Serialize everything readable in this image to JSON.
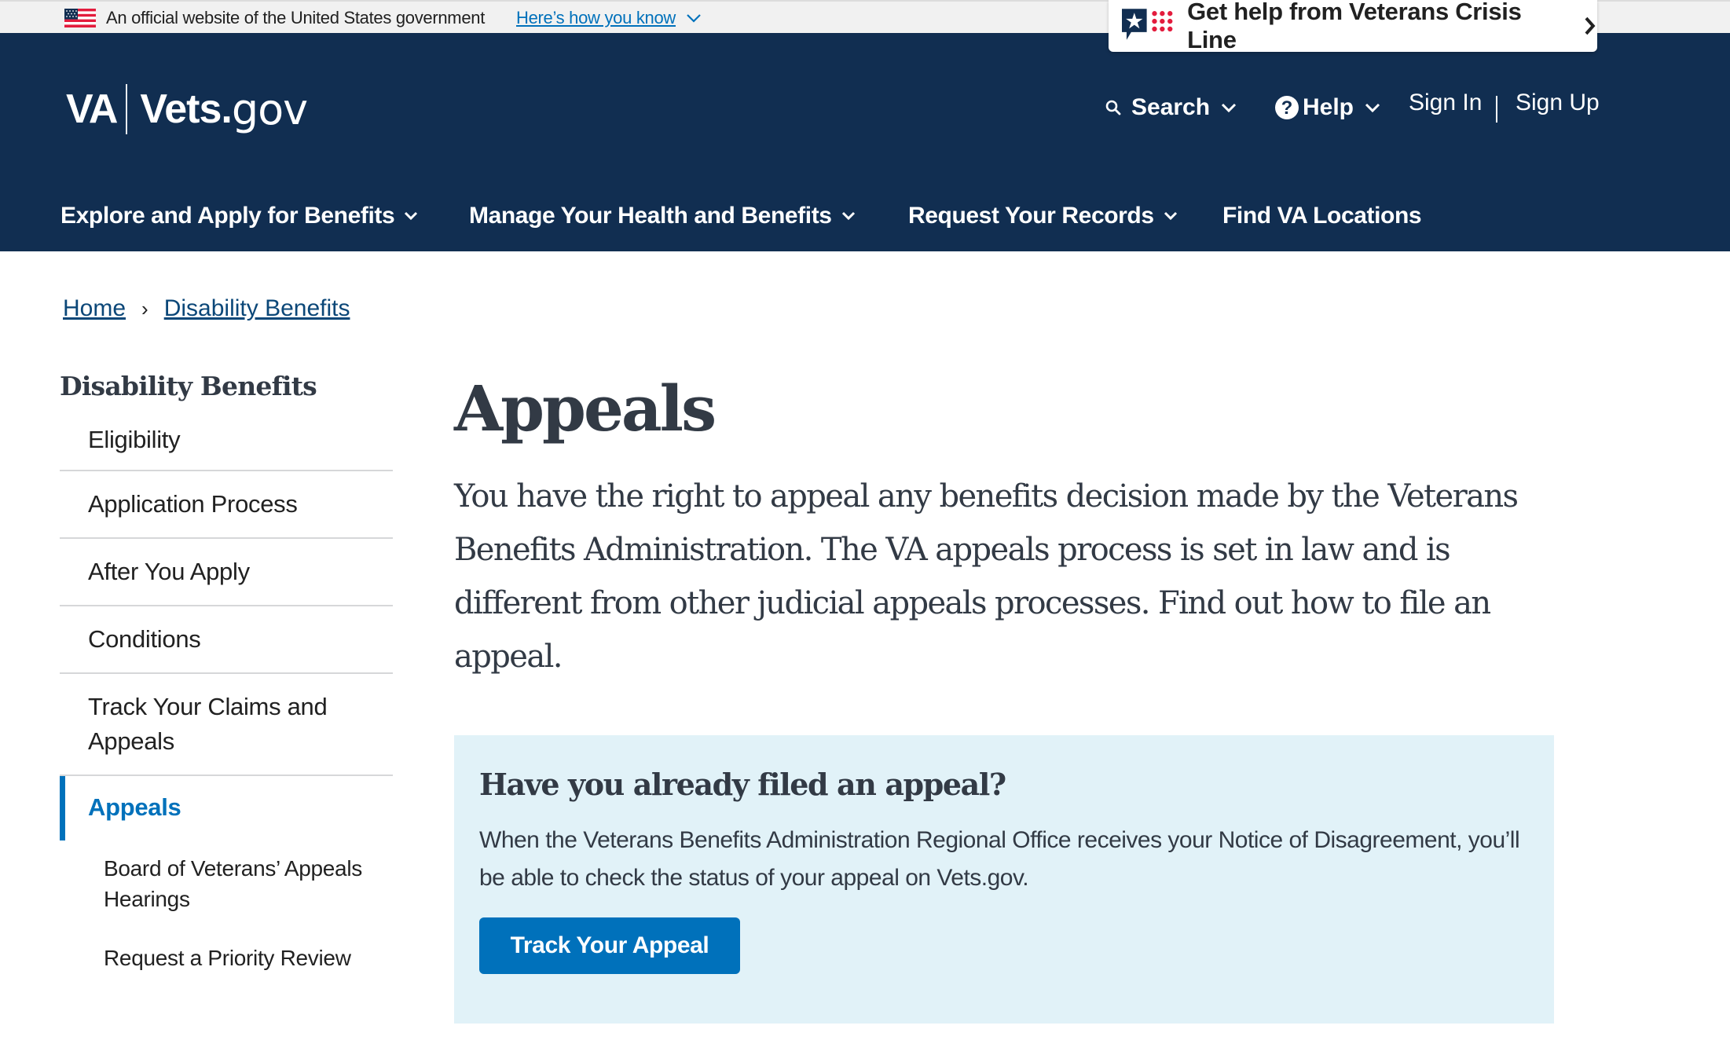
{
  "gov_banner": {
    "official_text": "An official website of the United States government",
    "how_link": "Here’s how you know",
    "flag_icon": "us-flag-icon",
    "chevron_icon": "chevron-down-icon"
  },
  "crisis_line": {
    "label": "Get help from Veterans Crisis Line",
    "icon": "crisis-line-icon",
    "chevron_icon": "chevron-right-icon",
    "colors": {
      "navy": "#112e51",
      "red": "#e31c3d"
    }
  },
  "header": {
    "logo": {
      "va": "VA",
      "vets": "Vets.",
      "gov": "gov"
    },
    "search_label": "Search",
    "help_label": "Help",
    "sign_in": "Sign In",
    "sign_up": "Sign Up",
    "background": "#112e51"
  },
  "main_nav": {
    "items": [
      {
        "label": "Explore and Apply for Benefits",
        "has_dropdown": true
      },
      {
        "label": "Manage Your Health and Benefits",
        "has_dropdown": true
      },
      {
        "label": "Request Your Records",
        "has_dropdown": true
      },
      {
        "label": "Find VA Locations",
        "has_dropdown": false
      }
    ]
  },
  "breadcrumb": {
    "items": [
      {
        "label": "Home"
      },
      {
        "label": "Disability Benefits"
      }
    ],
    "separator": "›"
  },
  "sidebar": {
    "title": "Disability Benefits",
    "items": [
      {
        "label": "Eligibility"
      },
      {
        "label": "Application Process"
      },
      {
        "label": "After You Apply"
      },
      {
        "label": "Conditions"
      },
      {
        "label": "Track Your Claims and Appeals"
      },
      {
        "label": "Appeals",
        "active": true
      }
    ],
    "sub_items": [
      {
        "label": "Board of Veterans’ Appeals Hearings"
      },
      {
        "label": "Request a Priority Review"
      }
    ],
    "active_color": "#0071bb"
  },
  "main": {
    "title": "Appeals",
    "intro": "You have the right to appeal any benefits decision made by the Veterans Benefits Administration. The VA appeals process is set in law and is different from other judicial appeals processes. Find out how to file an appeal.",
    "callout": {
      "title": "Have you already filed an appeal?",
      "body": "When the Veterans Benefits Administration Regional Office receives your Notice of Disagreement, you’ll be able to check the status of your appeal on Vets.gov.",
      "button_label": "Track Your Appeal",
      "background": "#e1f2f8",
      "button_color": "#0071bb"
    }
  }
}
